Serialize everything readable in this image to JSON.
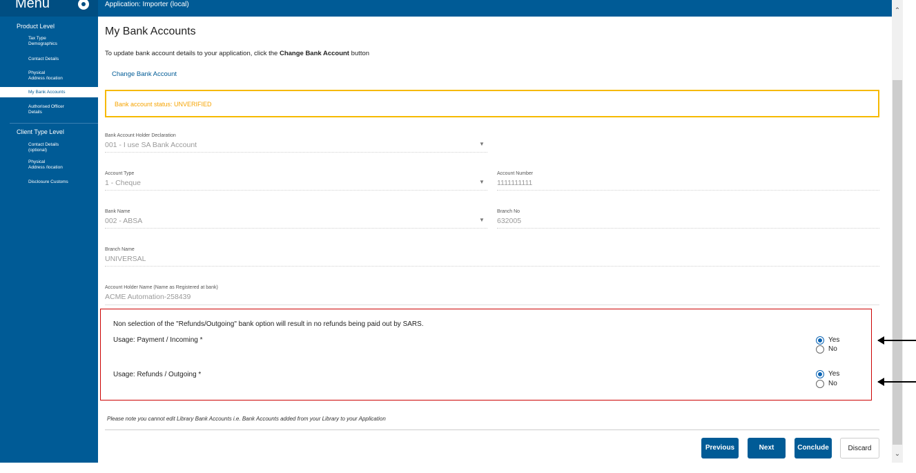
{
  "sidebar": {
    "menu_title": "Menu",
    "product_level_label": "Product Level",
    "product_items": [
      "Tax Type\nDemographics",
      "Contact Details",
      "Physical\nAddress /location",
      "My Bank Accounts",
      "Authorised Officer\nDetails"
    ],
    "client_level_label": "Client Type Level",
    "client_items": [
      "Contact Details\n(optional)",
      "Physical\nAddress /location",
      "Disclosure Customs"
    ]
  },
  "topbar": {
    "application": "Application: Importer (local)"
  },
  "main": {
    "title": "My Bank Accounts",
    "intro_prefix": "To update bank account details to your application, click the ",
    "intro_bold": "Change Bank Account",
    "intro_suffix": " button",
    "change_link": "Change Bank Account",
    "status": "Bank account status: UNVERIFIED",
    "fields": {
      "holder_declaration": {
        "label": "Bank Account Holder Declaration",
        "value": "001 - I use SA Bank Account"
      },
      "account_type": {
        "label": "Account Type",
        "value": "1 - Cheque"
      },
      "account_number": {
        "label": "Account Number",
        "value": "1111111111"
      },
      "bank_name": {
        "label": "Bank Name",
        "value": "002 - ABSA"
      },
      "branch_no": {
        "label": "Branch No",
        "value": "632005"
      },
      "branch_name": {
        "label": "Branch Name",
        "value": "UNIVERSAL"
      },
      "holder_name": {
        "label": "Account Holder Name (Name as Registered at bank)",
        "value": "ACME Automation-258439"
      }
    },
    "warning": "Non selection of the \"Refunds/Outgoing\" bank option will result in no refunds being paid out by SARS.",
    "usage_payment": {
      "label": "Usage: Payment / Incoming *",
      "yes": "Yes",
      "no": "No",
      "selected": "Yes"
    },
    "usage_refunds": {
      "label": "Usage: Refunds / Outgoing *",
      "yes": "Yes",
      "no": "No",
      "selected": "Yes"
    },
    "note": "Please note  you cannot edit Library Bank Accounts i.e. Bank Accounts added from your Library to your Application"
  },
  "buttons": {
    "previous": "Previous",
    "next": "Next",
    "conclude": "Conclude",
    "discard": "Discard"
  },
  "colors": {
    "brand_blue": "#005b96",
    "status_amber": "#f6b900",
    "highlight_red": "#cc0000",
    "radio_blue": "#0a63b3"
  },
  "icons": {
    "menu": "gear-icon",
    "select": "chevron-down-icon",
    "annotation": "arrow-left-icon"
  }
}
